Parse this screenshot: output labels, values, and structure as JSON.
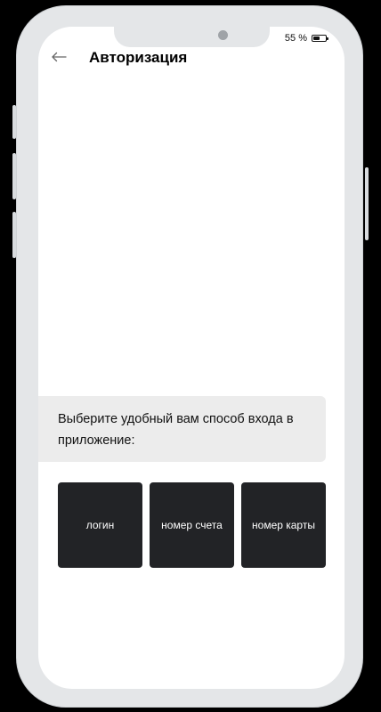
{
  "status_bar": {
    "battery_text": "55 %",
    "battery_level": 0.55
  },
  "header": {
    "back_icon": "arrow-left-icon",
    "title": "Авторизация"
  },
  "prompt": {
    "text": "Выберите удобный вам способ входа в приложение:"
  },
  "login_options": [
    {
      "label": "логин"
    },
    {
      "label": "номер счета"
    },
    {
      "label": "номер карты"
    }
  ],
  "colors": {
    "option_background": "#222326",
    "prompt_background": "#ececec",
    "device_frame": "#e4e6e8"
  }
}
